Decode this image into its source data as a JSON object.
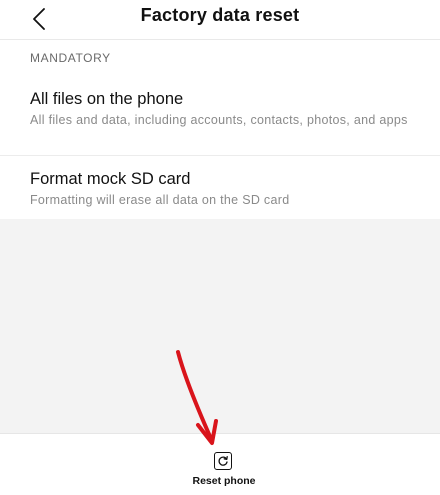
{
  "header": {
    "title": "Factory data reset",
    "back_icon": "chevron-left-icon"
  },
  "section": {
    "label": "MANDATORY"
  },
  "options": [
    {
      "title": "All files on the phone",
      "description": "All files and data, including accounts, contacts, photos, and apps"
    },
    {
      "title": "Format mock SD card",
      "description": "Formatting will erase all data on the SD card"
    }
  ],
  "bottom_bar": {
    "reset_label": "Reset phone",
    "reset_icon": "reset-icon"
  },
  "colors": {
    "annotation_arrow": "#d9141b",
    "filler_background": "#f3f3f3"
  }
}
